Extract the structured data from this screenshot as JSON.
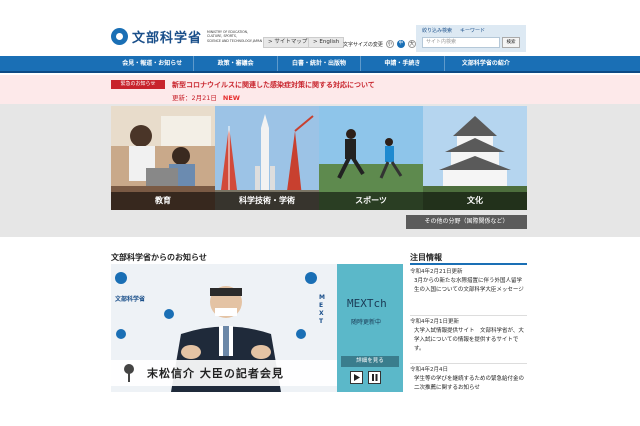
{
  "header": {
    "logo_text": "文部科学省",
    "logo_eng": [
      "MINISTRY OF EDUCATION,",
      "CULTURE, SPORTS,",
      "SCIENCE AND TECHNOLOGY-JAPAN"
    ],
    "sitemap": "> サイトマップ",
    "english": "> English",
    "font_size_label": "文字サイズの変更",
    "font_small": "小",
    "font_mid": "中",
    "font_big": "大",
    "search_tab1": "絞り込み検索",
    "search_tab2": "キーワード",
    "search_placeholder": "サイト内検索",
    "search_button": "検索"
  },
  "nav": {
    "items": [
      "会見・報道・お知らせ",
      "政策・審議会",
      "白書・統計・出版物",
      "申請・手続き",
      "文部科学省の紹介"
    ]
  },
  "emergency": {
    "badge": "緊急のお知らせ",
    "title": "新型コロナウイルスに関連した感染症対策に関する対応について",
    "date": "更新：2月21日",
    "new": "NEW"
  },
  "hero": {
    "tiles": [
      "教育",
      "科学技術・学術",
      "スポーツ",
      "文化"
    ],
    "other": "その他の分野（国際関係など）"
  },
  "news": {
    "title": "文部科学省からのお知らせ",
    "video_caption": "末松信介 大臣の記者会見",
    "mext_ch": "MEXTch",
    "mext_update": "随時更新中",
    "detail_button": "詳細を見る",
    "video_logo": "文部科学省",
    "video_mext": [
      "M",
      "E",
      "X",
      "T"
    ]
  },
  "aside": {
    "title": "注目情報",
    "items": [
      {
        "date": "令和4年2月21日更新",
        "body": "3月からの新たな水際措置に伴う外国人留学生の入国についての文部科学大臣メッセージ"
      },
      {
        "date": "令和4年2月1日更新",
        "body": "大学入試情報提供サイト　文部科学省が、大学入試についての情報を提供するサイトです。"
      },
      {
        "date": "令和4年2月4日",
        "body": "学生等の学びを継続するための緊急給付金の二次推薦に関するお知らせ"
      }
    ]
  },
  "colors": {
    "primary": "#1a6fb5",
    "emergency": "#c8232c",
    "emergency_bg": "#fde9ea"
  }
}
